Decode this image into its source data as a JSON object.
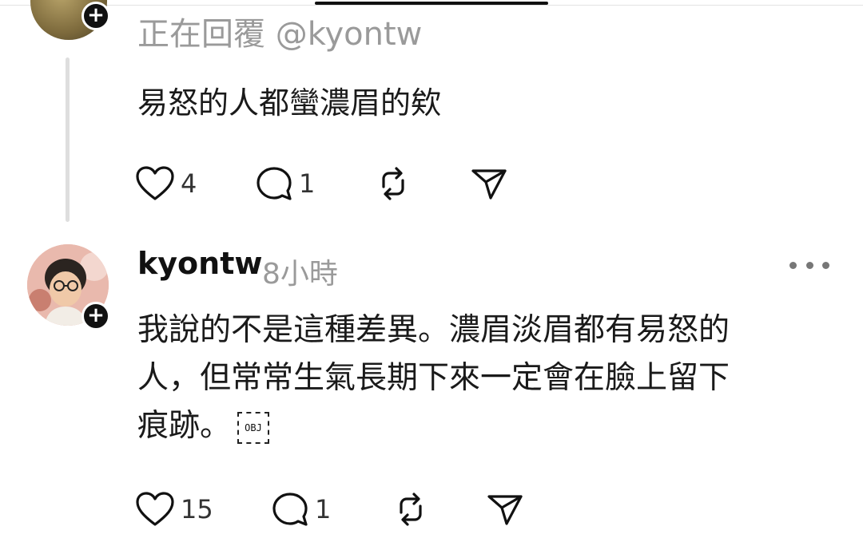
{
  "thread_reply": {
    "replying_to": "正在回覆 @kyontw",
    "text": "易怒的人都蠻濃眉的欸",
    "likes": "4",
    "replies": "1"
  },
  "comment": {
    "username": "kyontw",
    "time": "8小時",
    "lines": [
      "我說的不是這種差異。濃眉淡眉都有易怒的",
      "人，但常常生氣長期下來一定會在臉上留下",
      "痕跡。"
    ],
    "obj_marker": "OBJ",
    "likes": "15",
    "replies": "1"
  },
  "icons": {
    "like": "heart-icon",
    "reply": "comment-bubble-icon",
    "repost": "repost-icon",
    "share": "send-icon",
    "follow": "plus-icon",
    "more": "more-horizontal-icon"
  },
  "colors": {
    "text": "#1a1a1a",
    "muted": "#9a9a9a",
    "thread_line": "#dedede",
    "badge": "#111111"
  }
}
